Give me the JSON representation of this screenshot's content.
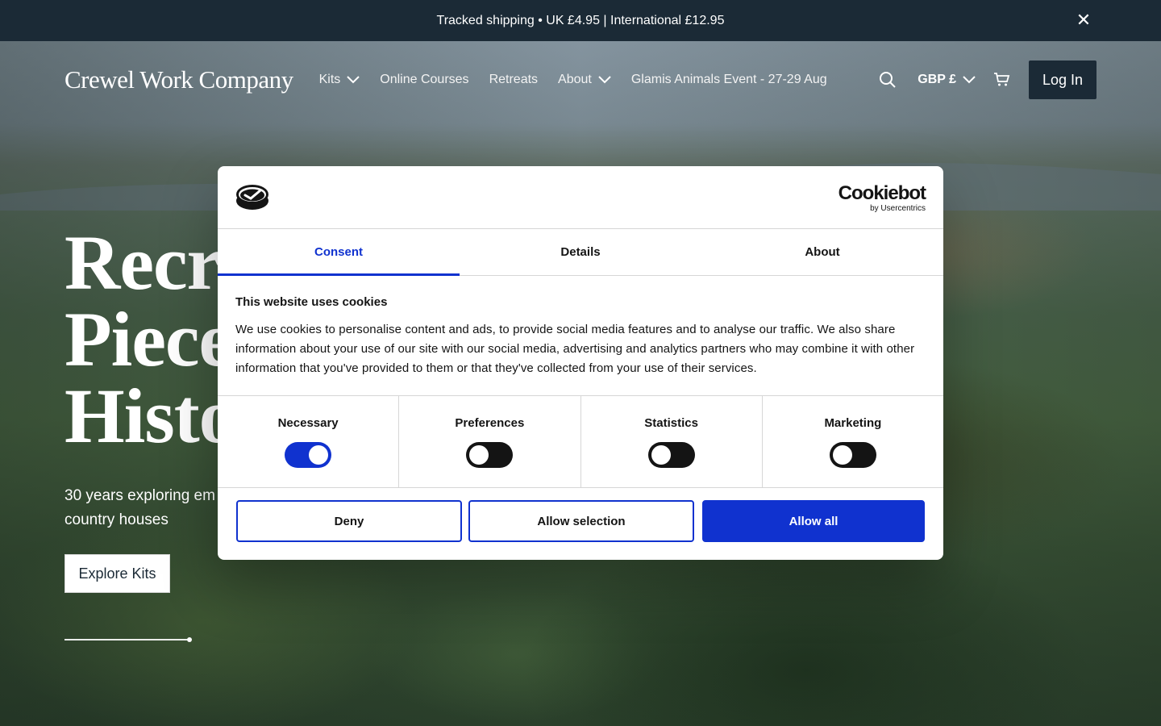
{
  "announcement": {
    "text": "Tracked shipping • UK £4.95 | International £12.95",
    "close_icon": "close-icon"
  },
  "header": {
    "logo": "Crewel Work Company",
    "nav": [
      {
        "label": "Kits",
        "dropdown": true
      },
      {
        "label": "Online Courses",
        "dropdown": false
      },
      {
        "label": "Retreats",
        "dropdown": false
      },
      {
        "label": "About",
        "dropdown": true
      },
      {
        "label": "Glamis Animals Event - 27-29 Aug",
        "dropdown": false
      }
    ],
    "currency": "GBP £",
    "login_label": "Log In"
  },
  "hero": {
    "title_lines": [
      "Recre",
      "Piece",
      "Histo"
    ],
    "subtitle_lines": [
      "30 years exploring em",
      "country houses"
    ],
    "cta": "Explore Kits"
  },
  "cookie_dialog": {
    "brand_name": "Cookiebot",
    "brand_by": "by Usercentrics",
    "tabs": [
      "Consent",
      "Details",
      "About"
    ],
    "active_tab": "Consent",
    "title": "This website uses cookies",
    "text": "We use cookies to personalise content and ads, to provide social media features and to analyse our traffic. We also share information about your use of our site with our social media, advertising and analytics partners who may combine it with other information that you've provided to them or that they've collected from your use of their services.",
    "toggles": [
      {
        "label": "Necessary",
        "on": true
      },
      {
        "label": "Preferences",
        "on": false
      },
      {
        "label": "Statistics",
        "on": false
      },
      {
        "label": "Marketing",
        "on": false
      }
    ],
    "buttons": {
      "deny": "Deny",
      "allow_selection": "Allow selection",
      "allow_all": "Allow all"
    }
  },
  "colors": {
    "dark_navy": "#1b2a36",
    "cookiebot_blue": "#1032cf"
  }
}
